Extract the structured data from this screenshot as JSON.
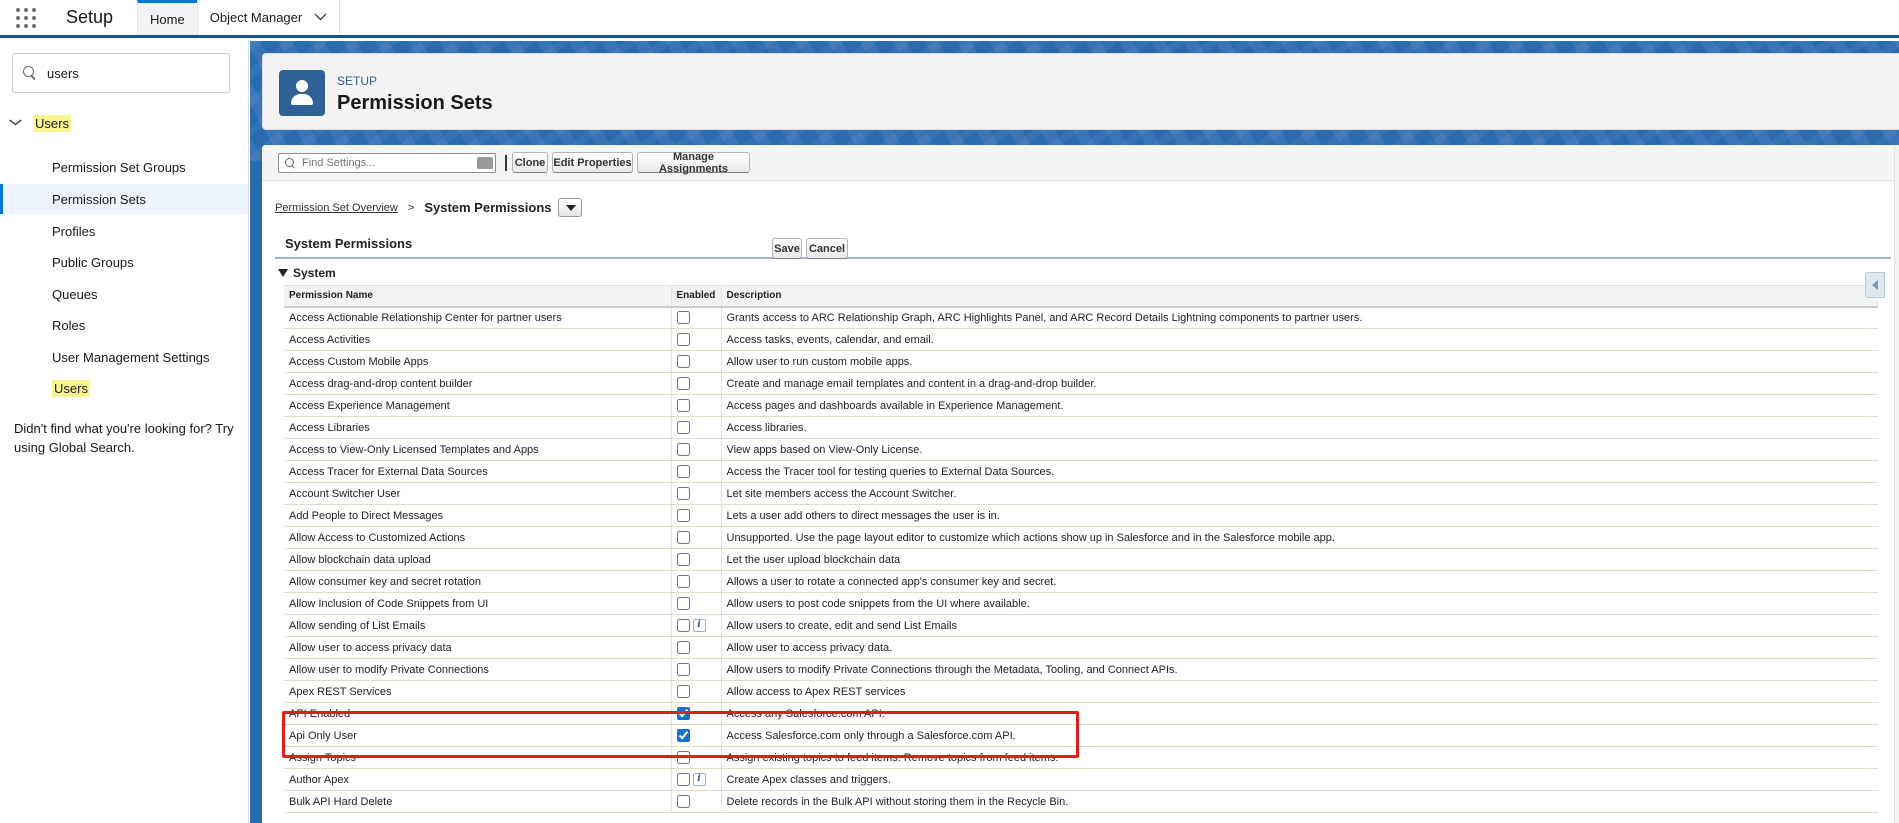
{
  "topnav": {
    "app_name": "Setup",
    "tabs": [
      {
        "label": "Home"
      },
      {
        "label": "Object Manager"
      }
    ]
  },
  "sidebar": {
    "search_value": "users",
    "root_label": "Users",
    "items": [
      {
        "label": "Permission Set Groups"
      },
      {
        "label": "Permission Sets"
      },
      {
        "label": "Profiles"
      },
      {
        "label": "Public Groups"
      },
      {
        "label": "Queues"
      },
      {
        "label": "Roles"
      },
      {
        "label": "User Management Settings"
      },
      {
        "label": "Users"
      }
    ],
    "help_text": "Didn't find what you're looking for? Try using Global Search."
  },
  "header": {
    "eyebrow": "SETUP",
    "title": "Permission Sets"
  },
  "toolbar": {
    "find_placeholder": "Find Settings...",
    "clone_label": "Clone",
    "edit_properties_label": "Edit Properties",
    "manage_assignments_label": "Manage Assignments"
  },
  "breadcrumb": {
    "link": "Permission Set Overview",
    "separator": ">",
    "current": "System Permissions"
  },
  "section": {
    "title": "System Permissions",
    "save_label": "Save",
    "cancel_label": "Cancel",
    "group_label": "System"
  },
  "table": {
    "headers": [
      "Permission Name",
      "Enabled",
      "Description"
    ],
    "rows": [
      {
        "name": "Access Actionable Relationship Center for partner users",
        "enabled": false,
        "info": false,
        "description": "Grants access to ARC Relationship Graph, ARC Highlights Panel, and ARC Record Details Lightning components to partner users."
      },
      {
        "name": "Access Activities",
        "enabled": false,
        "info": false,
        "description": "Access tasks, events, calendar, and email."
      },
      {
        "name": "Access Custom Mobile Apps",
        "enabled": false,
        "info": false,
        "description": "Allow user to run custom mobile apps."
      },
      {
        "name": "Access drag-and-drop content builder",
        "enabled": false,
        "info": false,
        "description": "Create and manage email templates and content in a drag-and-drop builder."
      },
      {
        "name": "Access Experience Management",
        "enabled": false,
        "info": false,
        "description": "Access pages and dashboards available in Experience Management."
      },
      {
        "name": "Access Libraries",
        "enabled": false,
        "info": false,
        "description": "Access libraries."
      },
      {
        "name": "Access to View-Only Licensed Templates and Apps",
        "enabled": false,
        "info": false,
        "description": "View apps based on View-Only License."
      },
      {
        "name": "Access Tracer for External Data Sources",
        "enabled": false,
        "info": false,
        "description": "Access the Tracer tool for testing queries to External Data Sources."
      },
      {
        "name": "Account Switcher User",
        "enabled": false,
        "info": false,
        "description": "Let site members access the Account Switcher."
      },
      {
        "name": "Add People to Direct Messages",
        "enabled": false,
        "info": false,
        "description": "Lets a user add others to direct messages the user is in."
      },
      {
        "name": "Allow Access to Customized Actions",
        "enabled": false,
        "info": false,
        "description": "Unsupported. Use the page layout editor to customize which actions show up in Salesforce and in the Salesforce mobile app."
      },
      {
        "name": "Allow blockchain data upload",
        "enabled": false,
        "info": false,
        "description": "Let the user upload blockchain data"
      },
      {
        "name": "Allow consumer key and secret rotation",
        "enabled": false,
        "info": false,
        "description": "Allows a user to rotate a connected app's consumer key and secret."
      },
      {
        "name": "Allow Inclusion of Code Snippets from UI",
        "enabled": false,
        "info": false,
        "description": "Allow users to post code snippets from the UI where available."
      },
      {
        "name": "Allow sending of List Emails",
        "enabled": false,
        "info": true,
        "description": "Allow users to create, edit and send List Emails"
      },
      {
        "name": "Allow user to access privacy data",
        "enabled": false,
        "info": false,
        "description": "Allow user to access privacy data."
      },
      {
        "name": "Allow user to modify Private Connections",
        "enabled": false,
        "info": false,
        "description": "Allow users to modify Private Connections through the Metadata, Tooling, and Connect APIs."
      },
      {
        "name": "Apex REST Services",
        "enabled": false,
        "info": false,
        "description": "Allow access to Apex REST services"
      },
      {
        "name": "API Enabled",
        "enabled": true,
        "info": false,
        "description": "Access any Salesforce.com API."
      },
      {
        "name": "Api Only User",
        "enabled": true,
        "info": false,
        "description": "Access Salesforce.com only through a Salesforce.com API."
      },
      {
        "name": "Assign Topics",
        "enabled": false,
        "info": false,
        "description": "Assign existing topics to feed items. Remove topics from feed items."
      },
      {
        "name": "Author Apex",
        "enabled": false,
        "info": true,
        "description": "Create Apex classes and triggers."
      },
      {
        "name": "Bulk API Hard Delete",
        "enabled": false,
        "info": false,
        "description": "Delete records in the Bulk API without storing them in the Recycle Bin."
      }
    ]
  },
  "colors": {
    "nav_border": "#1b5297",
    "banner": "#2a6bb0",
    "highlight_box": "#e11d1d",
    "search_highlight": "#fbf58f",
    "header_icon": "#2f6196"
  }
}
